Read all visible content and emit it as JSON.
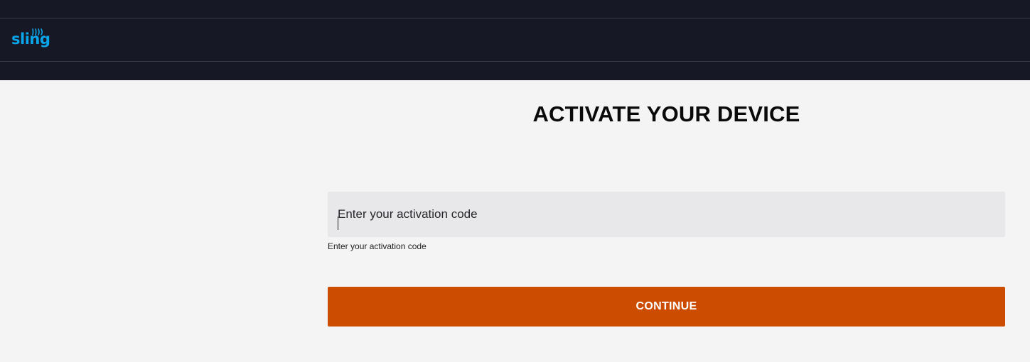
{
  "header": {
    "logo_text": "sling",
    "logo_icon": "signal-waves-icon",
    "brand_color": "#0ba5ec",
    "background_color": "#161925"
  },
  "main": {
    "title": "ACTIVATE YOUR DEVICE",
    "activation_input": {
      "value": "",
      "label": "Enter your activation code",
      "helper_text": "Enter your activation code"
    },
    "continue_button": {
      "label": "CONTINUE",
      "color": "#cc4c02"
    }
  }
}
